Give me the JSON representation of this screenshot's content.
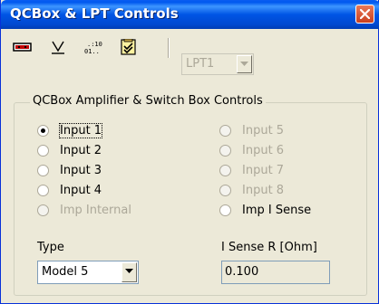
{
  "window": {
    "title": "QCBox & LPT Controls"
  },
  "toolbar": {
    "buttons": [
      {
        "name": "amplifier-icon"
      },
      {
        "name": "voltage-icon"
      },
      {
        "name": "binary-icon"
      },
      {
        "name": "checklist-icon"
      }
    ],
    "port_combo": {
      "value": "LPT1",
      "disabled": true
    }
  },
  "group": {
    "label": "QCBox Amplifier & Switch Box Controls",
    "radios": [
      {
        "label": "Input 1",
        "checked": true,
        "disabled": false
      },
      {
        "label": "Input 2",
        "checked": false,
        "disabled": false
      },
      {
        "label": "Input 3",
        "checked": false,
        "disabled": false
      },
      {
        "label": "Input 4",
        "checked": false,
        "disabled": false
      },
      {
        "label": "Imp Internal",
        "checked": false,
        "disabled": true
      },
      {
        "label": "Input 5",
        "checked": false,
        "disabled": true
      },
      {
        "label": "Input 6",
        "checked": false,
        "disabled": true
      },
      {
        "label": "Input 7",
        "checked": false,
        "disabled": true
      },
      {
        "label": "Input 8",
        "checked": false,
        "disabled": true
      },
      {
        "label": "Imp I Sense",
        "checked": false,
        "disabled": false
      }
    ],
    "type_label": "Type",
    "type_value": "Model 5",
    "isense_label": "I Sense R [Ohm]",
    "isense_value": "0.100"
  }
}
